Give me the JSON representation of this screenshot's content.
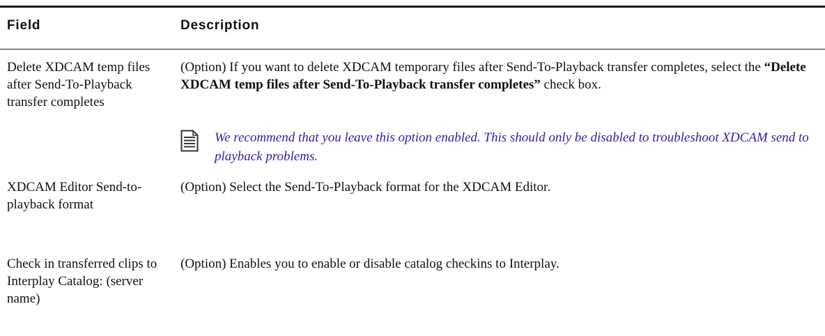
{
  "table": {
    "headers": {
      "field": "Field",
      "description": "Description"
    },
    "rows": [
      {
        "field": "Delete XDCAM temp files after Send-To-Playback transfer completes",
        "description_prefix": "(Option) If you want to delete XDCAM temporary files after Send-To-Playback transfer completes, select the ",
        "description_bold": "“Delete XDCAM temp files after Send-To-Playback transfer completes”",
        "description_suffix": " check box.",
        "note": {
          "icon": "note-icon",
          "text": "We recommend that you leave this option enabled. This should only be disabled to troubleshoot XDCAM send to playback problems."
        }
      },
      {
        "field": "XDCAM Editor Send-to-playback format",
        "description": "(Option) Select the Send-To-Playback format for the XDCAM Editor."
      },
      {
        "field": "Check in transferred clips to Interplay Catalog: (server name)",
        "description": "(Option) Enables you to enable or disable catalog checkins to Interplay."
      }
    ]
  },
  "colors": {
    "text": "#111111",
    "note_text": "#3a1aa8",
    "rules": "#1a1a1a"
  }
}
